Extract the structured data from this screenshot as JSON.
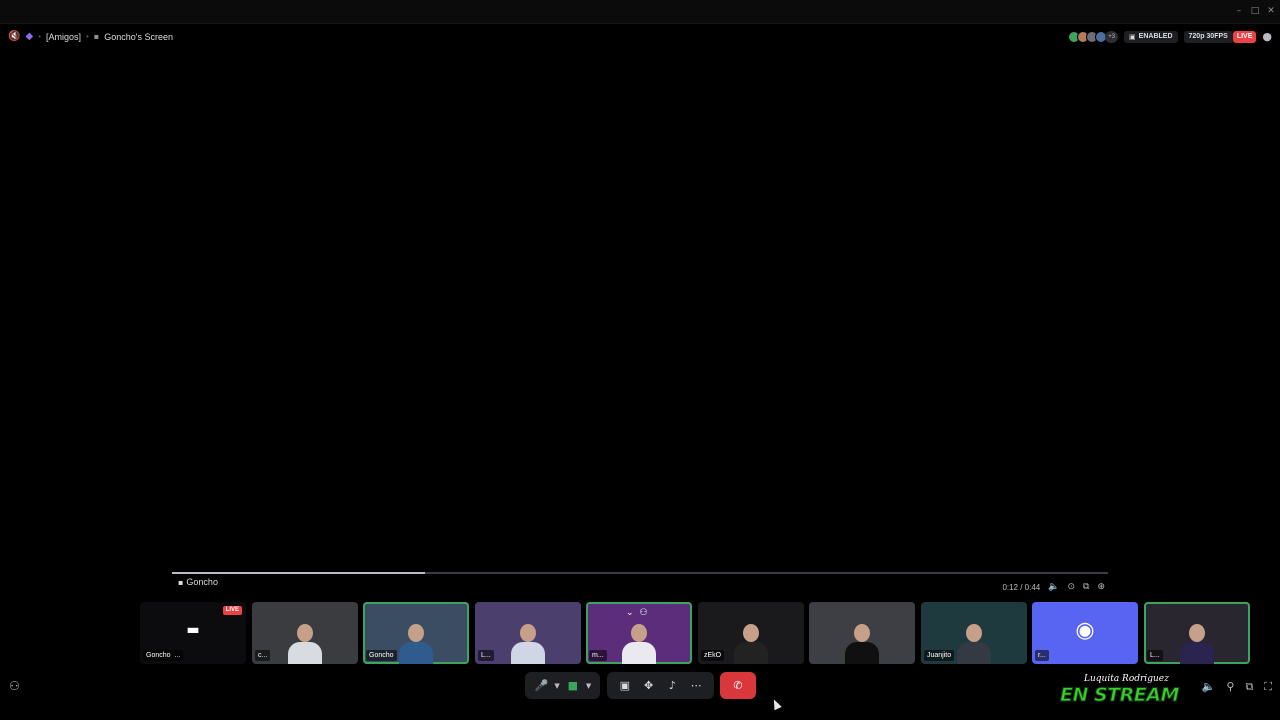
{
  "window": {
    "minimize": "–",
    "maximize": "□",
    "close": "✕"
  },
  "header": {
    "server": "[Amigos]",
    "stream_title": "Goncho's Screen",
    "viewers_more": "+3",
    "enabled_label": "ENABLED",
    "quality": "720p 30FPS",
    "live": "LIVE"
  },
  "player": {
    "streamer": "Goncho",
    "time": "0:12 / 0:44",
    "progress_fraction": 0.27
  },
  "tiles": [
    {
      "name": "Goncho",
      "suffix": "...",
      "live": "LIVE",
      "type": "stream",
      "speaking": false
    },
    {
      "name": "c...",
      "type": "cam",
      "speaking": false,
      "bg": "#3a3c3f",
      "shirt": "#d8dce2"
    },
    {
      "name": "Goncho",
      "type": "cam",
      "speaking": true,
      "bg": "#3b4d63",
      "shirt": "#2f5b8f"
    },
    {
      "name": "L...",
      "type": "cam",
      "speaking": false,
      "bg": "#4b3f6e",
      "shirt": "#cfd6e6"
    },
    {
      "name": "m...",
      "type": "cam",
      "speaking": true,
      "bg": "#5b2d7a",
      "shirt": "#e9e9ef"
    },
    {
      "name": "zEkO",
      "type": "cam",
      "speaking": false,
      "bg": "#1a1a1d",
      "shirt": "#222"
    },
    {
      "name": "",
      "type": "cam",
      "speaking": false,
      "bg": "#3d3f45",
      "shirt": "#101010"
    },
    {
      "name": "Juanjito",
      "type": "cam",
      "speaking": false,
      "bg": "#1f3a3e",
      "shirt": "#333a44"
    },
    {
      "name": "r...",
      "type": "discord",
      "speaking": false,
      "bg": "#5865f2"
    },
    {
      "name": "L...",
      "type": "cam",
      "speaking": true,
      "bg": "#2a2630",
      "shirt": "#2c2450"
    }
  ],
  "watermark": {
    "signature": "Luquita Rodriguez",
    "main": "EN STREAM"
  },
  "colors": {
    "live": "#ed4245",
    "speaking": "#3ba55d",
    "leave": "#da373c",
    "discord": "#5865f2"
  }
}
